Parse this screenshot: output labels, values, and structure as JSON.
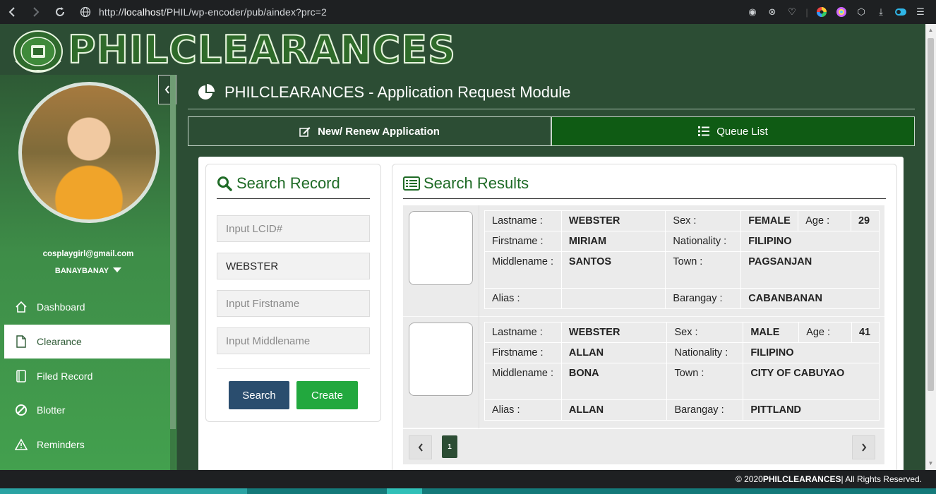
{
  "browser": {
    "url_prefix": "http://",
    "url_host": "localhost",
    "url_path": "/PHIL/wp-encoder/pub/aindex?prc=2"
  },
  "header": {
    "logo_text": "PHILCLEARANCES"
  },
  "sidebar": {
    "email": "cosplaygirl@gmail.com",
    "username": "BANAYBANAY",
    "items": [
      {
        "label": "Dashboard",
        "icon": "home-icon"
      },
      {
        "label": "Clearance",
        "icon": "document-icon",
        "active": true
      },
      {
        "label": "Filed Record",
        "icon": "book-icon"
      },
      {
        "label": "Blotter",
        "icon": "ban-icon"
      },
      {
        "label": "Reminders",
        "icon": "warning-icon"
      }
    ]
  },
  "main": {
    "title": "PHILCLEARANCES - Application Request Module",
    "tabs": {
      "new": "New/ Renew Application",
      "queue": "Queue List"
    }
  },
  "search": {
    "title": "Search Record",
    "lcid_placeholder": "Input LCID#",
    "lastname_value": "WEBSTER",
    "firstname_placeholder": "Input Firstname",
    "middlename_placeholder": "Input Middlename",
    "search_label": "Search",
    "create_label": "Create"
  },
  "results": {
    "title": "Search Results",
    "labels": {
      "lastname": "Lastname :",
      "firstname": "Firstname :",
      "middlename": "Middlename :",
      "alias": "Alias :",
      "sex": "Sex :",
      "age": "Age :",
      "nationality": "Nationality :",
      "town": "Town :",
      "barangay": "Barangay :"
    },
    "records": [
      {
        "lastname": "WEBSTER",
        "firstname": "MIRIAM",
        "middlename": "SANTOS",
        "alias": "",
        "sex": "FEMALE",
        "age": "29",
        "nationality": "FILIPINO",
        "town": "PAGSANJAN",
        "barangay": "CABANBANAN"
      },
      {
        "lastname": "WEBSTER",
        "firstname": "ALLAN",
        "middlename": "BONA",
        "alias": "ALLAN",
        "sex": "MALE",
        "age": "41",
        "nationality": "FILIPINO",
        "town": "CITY OF CABUYAO",
        "barangay": "PITTLAND"
      }
    ],
    "current_page": "1"
  },
  "footer": {
    "prefix": "© 2020 ",
    "brand": "PHILCLEARANCES",
    "suffix": " | All Rights Reserved."
  }
}
